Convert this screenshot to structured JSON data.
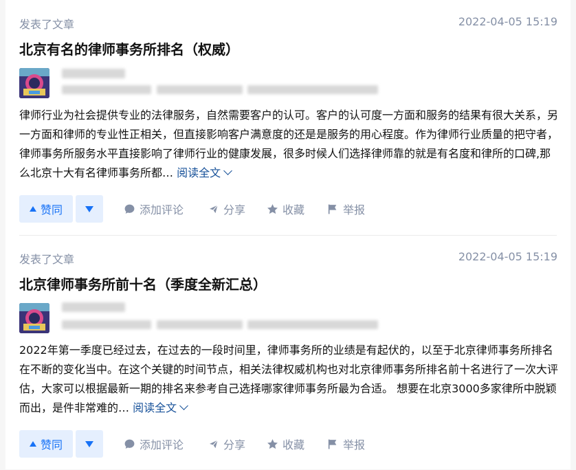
{
  "colors": {
    "accent": "#1772f6",
    "link": "#175199",
    "meta": "#8590a6",
    "vote_bg": "#e5effe"
  },
  "posts": [
    {
      "action_type": "发表了文章",
      "time": "2022-04-05 15:19",
      "title": "北京有名的律师事务所排名（权威）",
      "excerpt": "律师行业为社会提供专业的法律服务，自然需要客户的认可。客户的认可度一方面和服务的结果有很大关系，另一方面和律师的专业性正相关，但直接影响客户满意度的还是是服务的用心程度。作为律师行业质量的把守者，律师事务所服务水平直接影响了律师行业的健康发展，很多时候人们选择律师靠的就是有名度和律所的口碑,那么北京十大有名律师事务所都…",
      "read_more": "阅读全文",
      "actions": {
        "upvote": "赞同",
        "comment": "添加评论",
        "share": "分享",
        "collect": "收藏",
        "report": "举报"
      }
    },
    {
      "action_type": "发表了文章",
      "time": "2022-04-05 15:19",
      "title": "北京律师事务所前十名（季度全新汇总）",
      "excerpt": "2022年第一季度已经过去，在过去的一段时间里，律师事务所的业绩是有起伏的，以至于北京律师事务所排名在不断的变化当中。在这个关键的时间节点，相关法律权威机构也对北京律师事务所排名前十名进行了一次大评估，大家可以根据最新一期的排名来参考自己选择哪家律师事务所最为合适。 想要在北京3000多家律所中脱颖而出，是件非常难的…",
      "read_more": "阅读全文",
      "actions": {
        "upvote": "赞同",
        "comment": "添加评论",
        "share": "分享",
        "collect": "收藏",
        "report": "举报"
      }
    }
  ]
}
